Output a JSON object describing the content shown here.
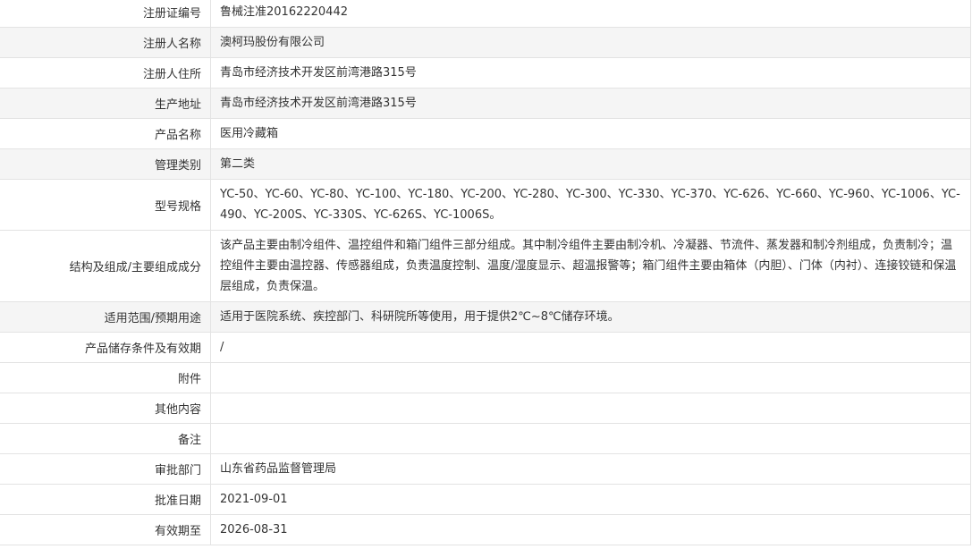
{
  "rows": [
    {
      "label": "注册证编号",
      "value": "鲁械注准20162220442"
    },
    {
      "label": "注册人名称",
      "value": "澳柯玛股份有限公司"
    },
    {
      "label": "注册人住所",
      "value": "青岛市经济技术开发区前湾港路315号"
    },
    {
      "label": "生产地址",
      "value": "青岛市经济技术开发区前湾港路315号"
    },
    {
      "label": "产品名称",
      "value": "医用冷藏箱"
    },
    {
      "label": "管理类别",
      "value": "第二类"
    },
    {
      "label": "型号规格",
      "value": "YC-50、YC-60、YC-80、YC-100、YC-180、YC-200、YC-280、YC-300、YC-330、YC-370、YC-626、YC-660、YC-960、YC-1006、YC-490、YC-200S、YC-330S、YC-626S、YC-1006S。"
    },
    {
      "label": "结构及组成/主要组成成分",
      "value": "该产品主要由制冷组件、温控组件和箱门组件三部分组成。其中制冷组件主要由制冷机、冷凝器、节流件、蒸发器和制冷剂组成，负责制冷；温控组件主要由温控器、传感器组成，负责温度控制、温度/湿度显示、超温报警等；箱门组件主要由箱体（内胆）、门体（内衬）、连接铰链和保温层组成，负责保温。"
    },
    {
      "label": "适用范围/预期用途",
      "value": "适用于医院系统、疾控部门、科研院所等使用，用于提供2℃~8℃储存环境。"
    },
    {
      "label": "产品储存条件及有效期",
      "value": "/"
    },
    {
      "label": "附件",
      "value": ""
    },
    {
      "label": "其他内容",
      "value": ""
    },
    {
      "label": "备注",
      "value": ""
    },
    {
      "label": "审批部门",
      "value": "山东省药品监督管理局"
    },
    {
      "label": "批准日期",
      "value": "2021-09-01"
    },
    {
      "label": "有效期至",
      "value": "2026-08-31"
    }
  ]
}
